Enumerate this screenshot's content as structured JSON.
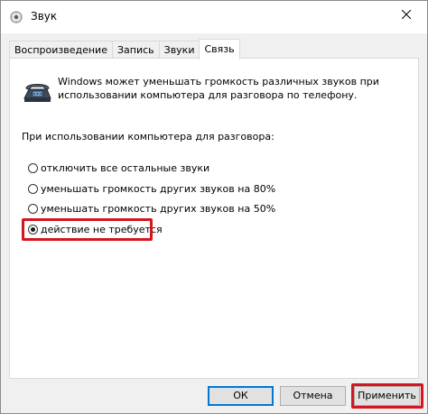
{
  "window": {
    "title": "Звук"
  },
  "tabs": [
    {
      "label": "Воспроизведение",
      "active": false
    },
    {
      "label": "Запись",
      "active": false
    },
    {
      "label": "Звуки",
      "active": false
    },
    {
      "label": "Связь",
      "active": true
    }
  ],
  "communications": {
    "description": "Windows может уменьшать громкость различных звуков при использовании компьютера для разговора по телефону.",
    "question": "При использовании компьютера для разговора:",
    "options": [
      {
        "label": "отключить все остальные звуки",
        "selected": false
      },
      {
        "label": "уменьшать громкость других звуков на 80%",
        "selected": false
      },
      {
        "label": "уменьшать громкость других звуков на 50%",
        "selected": false
      },
      {
        "label": "действие не требуется",
        "selected": true
      }
    ]
  },
  "buttons": {
    "ok_label": "ОК",
    "cancel_label": "Отмена",
    "apply_label": "Применить"
  },
  "icons": {
    "title": "speaker-icon",
    "close": "close-icon",
    "phone": "telephone-icon"
  },
  "colors": {
    "highlight": "#d6161e",
    "focus": "#0078d7"
  }
}
